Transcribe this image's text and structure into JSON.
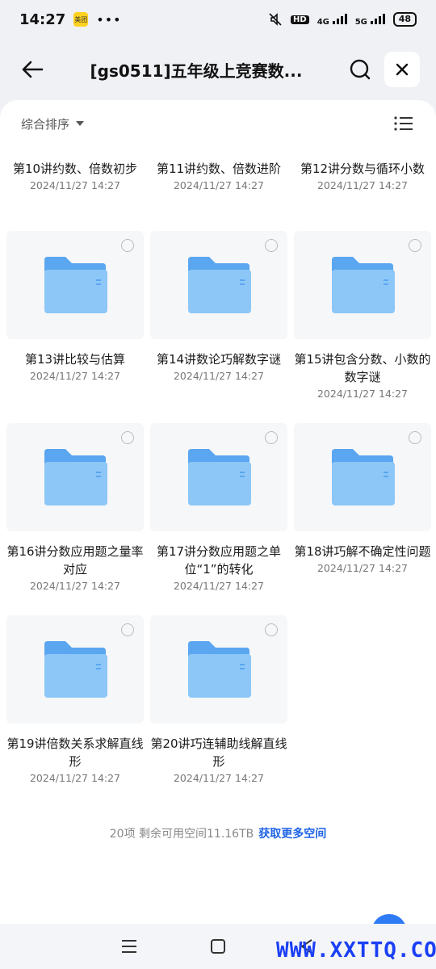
{
  "status": {
    "time": "14:27",
    "app_badge": "美团",
    "dots": "•••",
    "hd": "HD",
    "net1": "4G",
    "net2": "5G",
    "battery": "48"
  },
  "header": {
    "title": "[gs0511]五年级上竞赛数..."
  },
  "sort": {
    "label": "综合排序"
  },
  "top_row": [
    {
      "name": "第10讲约数、倍数初步",
      "date": "2024/11/27 14:27"
    },
    {
      "name": "第11讲约数、倍数进阶",
      "date": "2024/11/27 14:27"
    },
    {
      "name": "第12讲分数与循环小数",
      "date": "2024/11/27 14:27"
    }
  ],
  "folders": [
    {
      "name": "第13讲比较与估算",
      "date": "2024/11/27 14:27"
    },
    {
      "name": "第14讲数论巧解数字谜",
      "date": "2024/11/27 14:27"
    },
    {
      "name": "第15讲包含分数、小数的数字谜",
      "date": "2024/11/27 14:27"
    },
    {
      "name": "第16讲分数应用题之量率对应",
      "date": "2024/11/27 14:27"
    },
    {
      "name": "第17讲分数应用题之单位“1”的转化",
      "date": "2024/11/27 14:27"
    },
    {
      "name": "第18讲巧解不确定性问题",
      "date": "2024/11/27 14:27"
    },
    {
      "name": "第19讲倍数关系求解直线形",
      "date": "2024/11/27 14:27"
    },
    {
      "name": "第20讲巧连辅助线解直线形",
      "date": "2024/11/27 14:27"
    }
  ],
  "footer": {
    "summary": "20项 剩余可用空间11.16TB",
    "link": "获取更多空间"
  },
  "watermark": "WWW.XXTTQ.COM",
  "colors": {
    "accent": "#1e63e6",
    "folder": "#7cc0f5"
  }
}
